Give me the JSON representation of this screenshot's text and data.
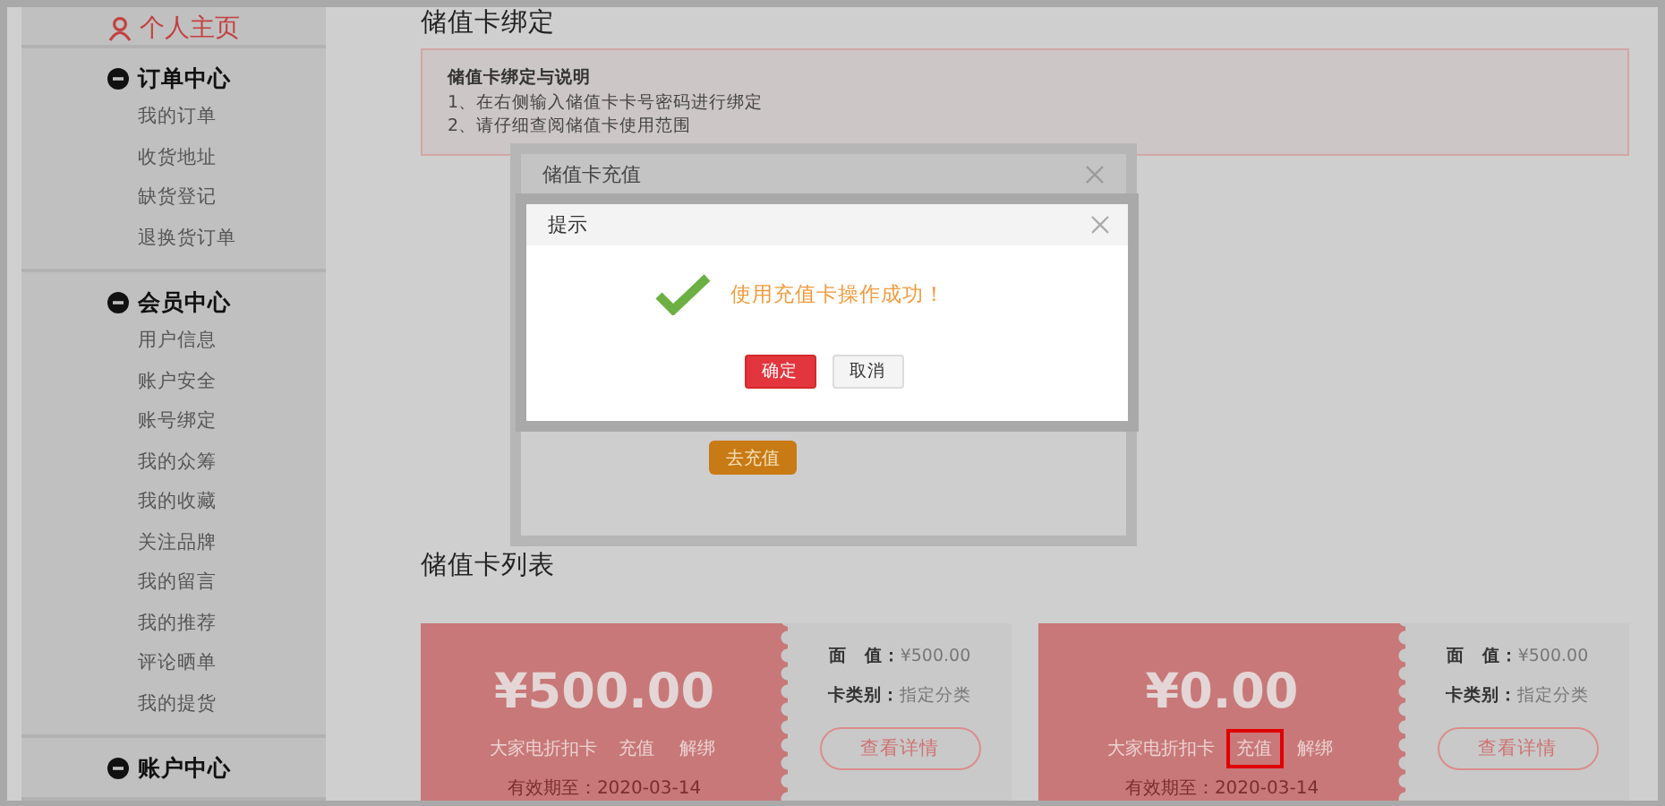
{
  "sidebar": {
    "header": "个人主页",
    "sections": [
      {
        "title": "订单中心",
        "expanded": true,
        "items": [
          "我的订单",
          "收货地址",
          "缺货登记",
          "退换货订单"
        ]
      },
      {
        "title": "会员中心",
        "expanded": true,
        "items": [
          "用户信息",
          "账户安全",
          "账号绑定",
          "我的众筹",
          "我的收藏",
          "关注品牌",
          "我的留言",
          "我的推荐",
          "评论晒单",
          "我的提货"
        ]
      },
      {
        "title": "账户中心",
        "expanded": true
      }
    ]
  },
  "binding": {
    "title": "储值卡绑定",
    "notice_title": "储值卡绑定与说明",
    "notice_lines": [
      "1、在右侧输入储值卡卡号密码进行绑定",
      "2、请仔细查阅储值卡使用范围"
    ]
  },
  "recharge_dialog": {
    "title": "储值卡充值",
    "button": "去充值"
  },
  "prompt_dialog": {
    "title": "提示",
    "message": "使用充值卡操作成功！",
    "buttons": [
      {
        "label": "确定",
        "kind": "primary"
      },
      {
        "label": "取消",
        "kind": "default"
      }
    ]
  },
  "card_list": {
    "title": "储值卡列表",
    "cards": [
      {
        "amount": "¥500.00",
        "name": "大家电折扣卡",
        "actions": [
          {
            "label": "充值",
            "highlighted": false
          },
          {
            "label": "解绑",
            "highlighted": false
          }
        ],
        "expiry": "有效期至：2020-03-14",
        "face_label": "面　值：",
        "face_value": "¥500.00",
        "type_label": "卡类别：",
        "type_value": "指定分类",
        "details_button": "查看详情"
      },
      {
        "amount": "¥0.00",
        "name": "大家电折扣卡",
        "actions": [
          {
            "label": "充值",
            "highlighted": true
          },
          {
            "label": "解绑",
            "highlighted": false
          }
        ],
        "expiry": "有效期至：2020-03-14",
        "face_label": "面　值：",
        "face_value": "¥500.00",
        "type_label": "卡类别：",
        "type_value": "指定分类",
        "details_button": "查看详情"
      }
    ]
  }
}
